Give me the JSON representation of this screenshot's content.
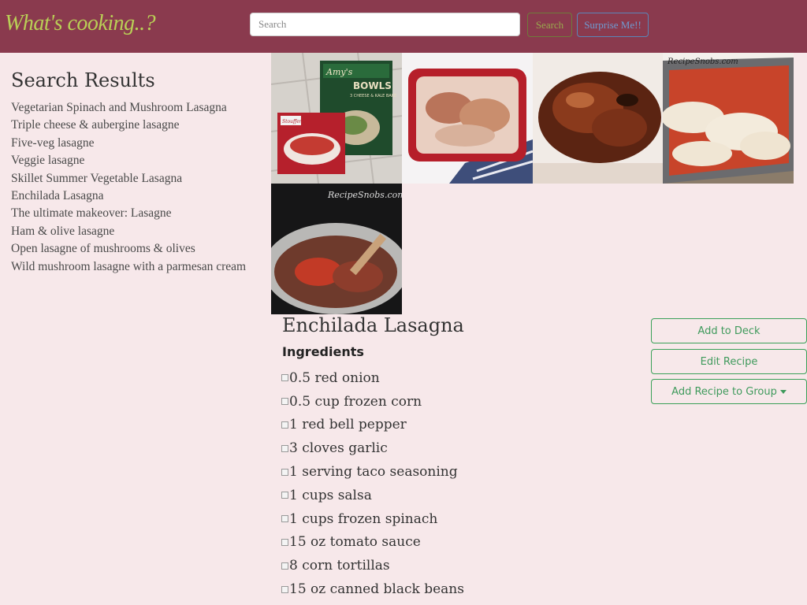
{
  "brand": {
    "title": "What's cooking..?"
  },
  "search": {
    "placeholder": "Search",
    "value": "",
    "button_label": "Search",
    "surprise_label": "Surprise Me!!"
  },
  "results": {
    "title": "Search Results",
    "items": [
      "Vegetarian Spinach and Mushroom Lasagna",
      "Triple cheese & aubergine lasagne",
      "Five-veg lasagne",
      "Veggie lasagne",
      "Skillet Summer Vegetable Lasagna",
      "Enchilada Lasagna",
      "The ultimate makeover: Lasagne",
      "Ham & olive lasagne",
      "Open lasagne of mushrooms & olives",
      "Wild mushroom lasagne with a parmesan cream"
    ]
  },
  "photos": {
    "p1_brand_top": "Amy's",
    "p1_label": "BOWLS",
    "p1_sub": "3 CHEESE & KALE BAKE",
    "p1_brand_bottom": "Stouffer's",
    "p4_watermark": "RecipeSnobs.com",
    "p5_watermark": "RecipeSnobs.com"
  },
  "recipe": {
    "title": "Enchilada Lasagna",
    "ingredients_heading": "Ingredients",
    "ingredients": [
      "0.5 red onion",
      "0.5 cup frozen corn",
      "1 red bell pepper",
      "3 cloves garlic",
      "1 serving taco seasoning",
      "1 cups salsa",
      "1 cups frozen spinach",
      "15 oz tomato sauce",
      "8 corn tortillas",
      "15 oz canned black beans"
    ],
    "actions": {
      "add_to_deck": "Add to Deck",
      "edit_recipe": "Edit Recipe",
      "add_to_group": "Add Recipe to Group"
    }
  },
  "colors": {
    "navbar": "#8a3a4e",
    "background": "#f7e8ea",
    "brand": "#b9cf56",
    "accent_green": "#3aa058",
    "accent_blue": "#6f9bd1"
  }
}
